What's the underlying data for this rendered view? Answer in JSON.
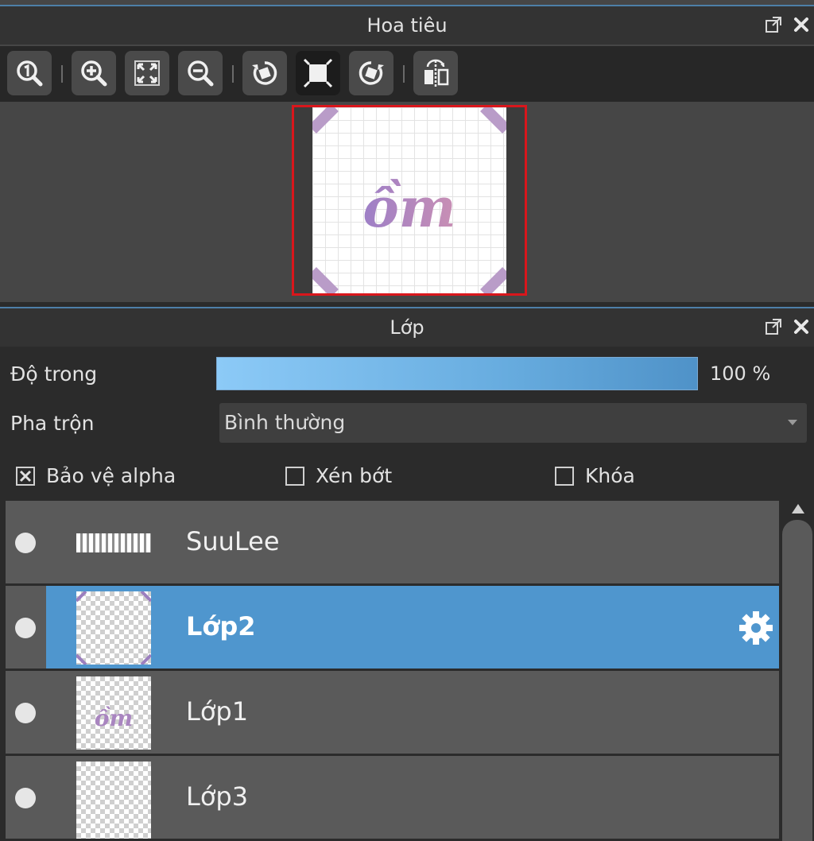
{
  "navigator": {
    "title": "Hoa tiêu",
    "toolbar": [
      {
        "icon": "zoom-actual-icon"
      },
      {
        "icon": "zoom-in-icon"
      },
      {
        "icon": "zoom-fit-icon"
      },
      {
        "icon": "zoom-out-icon"
      },
      {
        "icon": "rotate-left-icon"
      },
      {
        "icon": "rotation-reset-icon",
        "active": true
      },
      {
        "icon": "rotate-right-icon"
      },
      {
        "icon": "flip-horizontal-icon"
      }
    ],
    "preview_text": "ồm"
  },
  "layers": {
    "title": "Lớp",
    "opacity_label": "Độ trong",
    "opacity_value": "100 %",
    "opacity_fraction": 1.0,
    "blend_label": "Pha trộn",
    "blend_value": "Bình thường",
    "checkboxes": {
      "protect_alpha": {
        "label": "Bảo vệ alpha",
        "checked": true
      },
      "clipping": {
        "label": "Xén bớt",
        "checked": false
      },
      "lock": {
        "label": "Khóa",
        "checked": false
      }
    },
    "items": [
      {
        "name": "SuuLee",
        "selected": false
      },
      {
        "name": "Lớp2",
        "selected": true
      },
      {
        "name": "Lớp1",
        "selected": false
      },
      {
        "name": "Lớp3",
        "selected": false
      }
    ],
    "thumb_text": "ồm"
  },
  "colors": {
    "accent": "#4f96ce",
    "frame": "#d9161c",
    "ink": "#a985c0",
    "diagonal": "#b99cc8"
  }
}
